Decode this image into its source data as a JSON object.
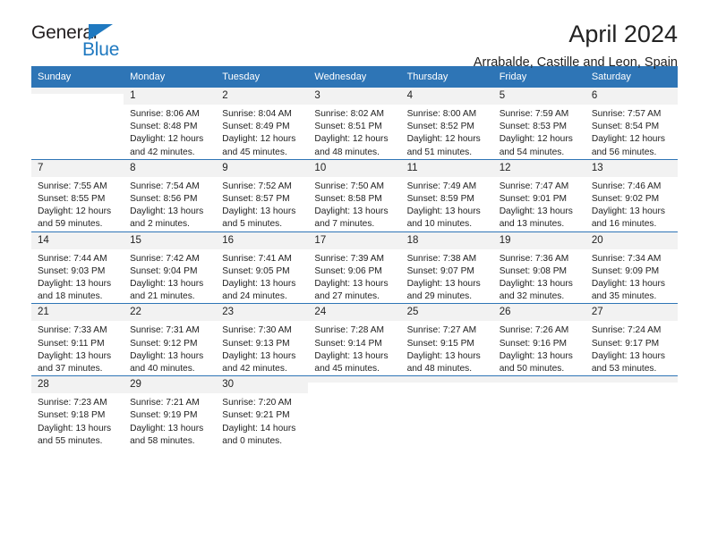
{
  "brand": {
    "line1": "General",
    "line2": "Blue",
    "triangle_icon": "triangle-icon",
    "accent_color": "#1f79c0"
  },
  "header": {
    "month_title": "April 2024",
    "location": "Arrabalde, Castille and Leon, Spain"
  },
  "theme": {
    "header_bg": "#2e75b6",
    "header_text": "#ffffff",
    "daynum_bg": "#f2f2f2",
    "body_text": "#222222"
  },
  "calendar": {
    "weekday_headers": [
      "Sunday",
      "Monday",
      "Tuesday",
      "Wednesday",
      "Thursday",
      "Friday",
      "Saturday"
    ],
    "labels": {
      "sunrise": "Sunrise:",
      "sunset": "Sunset:",
      "daylight": "Daylight:"
    },
    "weeks": [
      [
        {
          "day": "",
          "sunrise": "",
          "sunset": "",
          "daylight_1": "",
          "daylight_2": ""
        },
        {
          "day": "1",
          "sunrise": "Sunrise: 8:06 AM",
          "sunset": "Sunset: 8:48 PM",
          "daylight_1": "Daylight: 12 hours",
          "daylight_2": "and 42 minutes."
        },
        {
          "day": "2",
          "sunrise": "Sunrise: 8:04 AM",
          "sunset": "Sunset: 8:49 PM",
          "daylight_1": "Daylight: 12 hours",
          "daylight_2": "and 45 minutes."
        },
        {
          "day": "3",
          "sunrise": "Sunrise: 8:02 AM",
          "sunset": "Sunset: 8:51 PM",
          "daylight_1": "Daylight: 12 hours",
          "daylight_2": "and 48 minutes."
        },
        {
          "day": "4",
          "sunrise": "Sunrise: 8:00 AM",
          "sunset": "Sunset: 8:52 PM",
          "daylight_1": "Daylight: 12 hours",
          "daylight_2": "and 51 minutes."
        },
        {
          "day": "5",
          "sunrise": "Sunrise: 7:59 AM",
          "sunset": "Sunset: 8:53 PM",
          "daylight_1": "Daylight: 12 hours",
          "daylight_2": "and 54 minutes."
        },
        {
          "day": "6",
          "sunrise": "Sunrise: 7:57 AM",
          "sunset": "Sunset: 8:54 PM",
          "daylight_1": "Daylight: 12 hours",
          "daylight_2": "and 56 minutes."
        }
      ],
      [
        {
          "day": "7",
          "sunrise": "Sunrise: 7:55 AM",
          "sunset": "Sunset: 8:55 PM",
          "daylight_1": "Daylight: 12 hours",
          "daylight_2": "and 59 minutes."
        },
        {
          "day": "8",
          "sunrise": "Sunrise: 7:54 AM",
          "sunset": "Sunset: 8:56 PM",
          "daylight_1": "Daylight: 13 hours",
          "daylight_2": "and 2 minutes."
        },
        {
          "day": "9",
          "sunrise": "Sunrise: 7:52 AM",
          "sunset": "Sunset: 8:57 PM",
          "daylight_1": "Daylight: 13 hours",
          "daylight_2": "and 5 minutes."
        },
        {
          "day": "10",
          "sunrise": "Sunrise: 7:50 AM",
          "sunset": "Sunset: 8:58 PM",
          "daylight_1": "Daylight: 13 hours",
          "daylight_2": "and 7 minutes."
        },
        {
          "day": "11",
          "sunrise": "Sunrise: 7:49 AM",
          "sunset": "Sunset: 8:59 PM",
          "daylight_1": "Daylight: 13 hours",
          "daylight_2": "and 10 minutes."
        },
        {
          "day": "12",
          "sunrise": "Sunrise: 7:47 AM",
          "sunset": "Sunset: 9:01 PM",
          "daylight_1": "Daylight: 13 hours",
          "daylight_2": "and 13 minutes."
        },
        {
          "day": "13",
          "sunrise": "Sunrise: 7:46 AM",
          "sunset": "Sunset: 9:02 PM",
          "daylight_1": "Daylight: 13 hours",
          "daylight_2": "and 16 minutes."
        }
      ],
      [
        {
          "day": "14",
          "sunrise": "Sunrise: 7:44 AM",
          "sunset": "Sunset: 9:03 PM",
          "daylight_1": "Daylight: 13 hours",
          "daylight_2": "and 18 minutes."
        },
        {
          "day": "15",
          "sunrise": "Sunrise: 7:42 AM",
          "sunset": "Sunset: 9:04 PM",
          "daylight_1": "Daylight: 13 hours",
          "daylight_2": "and 21 minutes."
        },
        {
          "day": "16",
          "sunrise": "Sunrise: 7:41 AM",
          "sunset": "Sunset: 9:05 PM",
          "daylight_1": "Daylight: 13 hours",
          "daylight_2": "and 24 minutes."
        },
        {
          "day": "17",
          "sunrise": "Sunrise: 7:39 AM",
          "sunset": "Sunset: 9:06 PM",
          "daylight_1": "Daylight: 13 hours",
          "daylight_2": "and 27 minutes."
        },
        {
          "day": "18",
          "sunrise": "Sunrise: 7:38 AM",
          "sunset": "Sunset: 9:07 PM",
          "daylight_1": "Daylight: 13 hours",
          "daylight_2": "and 29 minutes."
        },
        {
          "day": "19",
          "sunrise": "Sunrise: 7:36 AM",
          "sunset": "Sunset: 9:08 PM",
          "daylight_1": "Daylight: 13 hours",
          "daylight_2": "and 32 minutes."
        },
        {
          "day": "20",
          "sunrise": "Sunrise: 7:34 AM",
          "sunset": "Sunset: 9:09 PM",
          "daylight_1": "Daylight: 13 hours",
          "daylight_2": "and 35 minutes."
        }
      ],
      [
        {
          "day": "21",
          "sunrise": "Sunrise: 7:33 AM",
          "sunset": "Sunset: 9:11 PM",
          "daylight_1": "Daylight: 13 hours",
          "daylight_2": "and 37 minutes."
        },
        {
          "day": "22",
          "sunrise": "Sunrise: 7:31 AM",
          "sunset": "Sunset: 9:12 PM",
          "daylight_1": "Daylight: 13 hours",
          "daylight_2": "and 40 minutes."
        },
        {
          "day": "23",
          "sunrise": "Sunrise: 7:30 AM",
          "sunset": "Sunset: 9:13 PM",
          "daylight_1": "Daylight: 13 hours",
          "daylight_2": "and 42 minutes."
        },
        {
          "day": "24",
          "sunrise": "Sunrise: 7:28 AM",
          "sunset": "Sunset: 9:14 PM",
          "daylight_1": "Daylight: 13 hours",
          "daylight_2": "and 45 minutes."
        },
        {
          "day": "25",
          "sunrise": "Sunrise: 7:27 AM",
          "sunset": "Sunset: 9:15 PM",
          "daylight_1": "Daylight: 13 hours",
          "daylight_2": "and 48 minutes."
        },
        {
          "day": "26",
          "sunrise": "Sunrise: 7:26 AM",
          "sunset": "Sunset: 9:16 PM",
          "daylight_1": "Daylight: 13 hours",
          "daylight_2": "and 50 minutes."
        },
        {
          "day": "27",
          "sunrise": "Sunrise: 7:24 AM",
          "sunset": "Sunset: 9:17 PM",
          "daylight_1": "Daylight: 13 hours",
          "daylight_2": "and 53 minutes."
        }
      ],
      [
        {
          "day": "28",
          "sunrise": "Sunrise: 7:23 AM",
          "sunset": "Sunset: 9:18 PM",
          "daylight_1": "Daylight: 13 hours",
          "daylight_2": "and 55 minutes."
        },
        {
          "day": "29",
          "sunrise": "Sunrise: 7:21 AM",
          "sunset": "Sunset: 9:19 PM",
          "daylight_1": "Daylight: 13 hours",
          "daylight_2": "and 58 minutes."
        },
        {
          "day": "30",
          "sunrise": "Sunrise: 7:20 AM",
          "sunset": "Sunset: 9:21 PM",
          "daylight_1": "Daylight: 14 hours",
          "daylight_2": "and 0 minutes."
        },
        {
          "day": "",
          "sunrise": "",
          "sunset": "",
          "daylight_1": "",
          "daylight_2": ""
        },
        {
          "day": "",
          "sunrise": "",
          "sunset": "",
          "daylight_1": "",
          "daylight_2": ""
        },
        {
          "day": "",
          "sunrise": "",
          "sunset": "",
          "daylight_1": "",
          "daylight_2": ""
        },
        {
          "day": "",
          "sunrise": "",
          "sunset": "",
          "daylight_1": "",
          "daylight_2": ""
        }
      ]
    ]
  }
}
